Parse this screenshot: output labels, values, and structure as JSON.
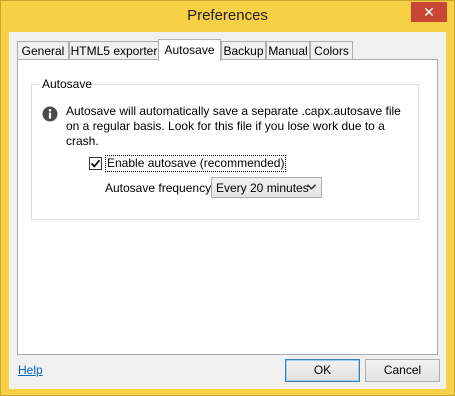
{
  "window": {
    "title": "Preferences",
    "close_glyph": "✕"
  },
  "tabs": [
    {
      "label": "General",
      "active": false
    },
    {
      "label": "HTML5 exporter",
      "active": false
    },
    {
      "label": "Autosave",
      "active": true
    },
    {
      "label": "Backup",
      "active": false
    },
    {
      "label": "Manual",
      "active": false
    },
    {
      "label": "Colors",
      "active": false
    }
  ],
  "autosave": {
    "group_title": "Autosave",
    "info_text": "Autosave will automatically save a separate .capx.autosave file on a regular basis. Look for this file if you lose work due to a crash.",
    "enable_label": "Enable autosave (recommended)",
    "enable_checked": true,
    "frequency_label": "Autosave frequency:",
    "frequency_value": "Every 20 minutes"
  },
  "footer": {
    "help_label": "Help",
    "ok_label": "OK",
    "cancel_label": "Cancel"
  },
  "colors": {
    "title_bar": "#f7d046",
    "close_button": "#c74635",
    "link": "#0066cc"
  },
  "icons": {
    "info": "info-icon",
    "close": "close-icon",
    "dropdown": "chevron-down-icon",
    "check": "check-icon"
  }
}
